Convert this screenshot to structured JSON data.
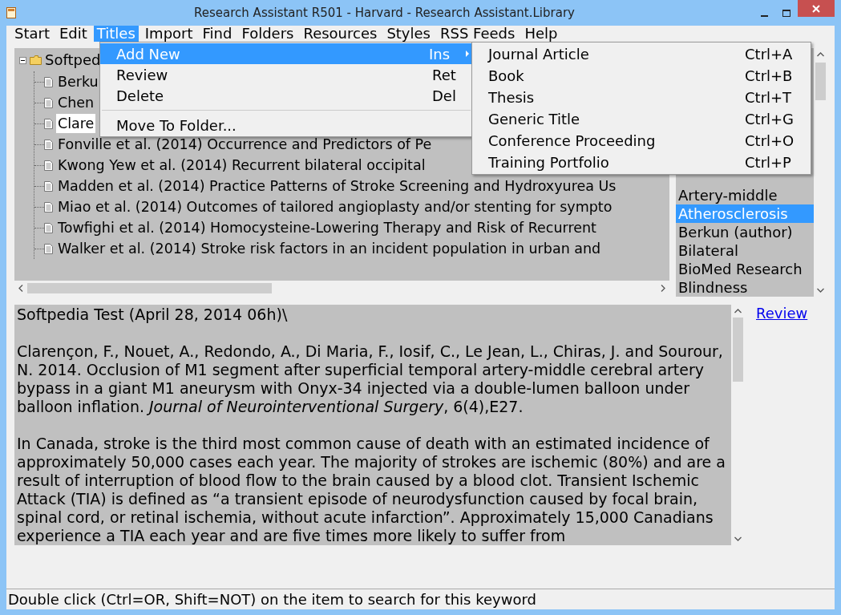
{
  "window": {
    "title": "Research Assistant R501 - Harvard - Research Assistant.Library"
  },
  "menu_bar": [
    {
      "label": "Start",
      "selected": false
    },
    {
      "label": "Edit",
      "selected": false
    },
    {
      "label": "Titles",
      "selected": true
    },
    {
      "label": "Import",
      "selected": false
    },
    {
      "label": "Find",
      "selected": false
    },
    {
      "label": "Folders",
      "selected": false
    },
    {
      "label": "Resources",
      "selected": false
    },
    {
      "label": "Styles",
      "selected": false
    },
    {
      "label": "RSS Feeds",
      "selected": false
    },
    {
      "label": "Help",
      "selected": false
    }
  ],
  "titles_menu": [
    {
      "kind": "item",
      "label": "Add New",
      "shortcut": "Ins",
      "selected": true,
      "submenu": true
    },
    {
      "kind": "item",
      "label": "Review",
      "shortcut": "Ret",
      "selected": false,
      "submenu": false
    },
    {
      "kind": "item",
      "label": "Delete",
      "shortcut": "Del",
      "selected": false,
      "submenu": false
    },
    {
      "kind": "separator"
    },
    {
      "kind": "item",
      "label": "Move To Folder...",
      "selected": false,
      "submenu": false
    }
  ],
  "add_new_submenu": [
    {
      "label": "Journal Article",
      "shortcut": "Ctrl+A"
    },
    {
      "label": "Book",
      "shortcut": "Ctrl+B"
    },
    {
      "label": "Thesis",
      "shortcut": "Ctrl+T"
    },
    {
      "label": "Generic Title",
      "shortcut": "Ctrl+G"
    },
    {
      "label": "Conference Proceeding",
      "shortcut": "Ctrl+O"
    },
    {
      "label": "Training Portfolio",
      "shortcut": "Ctrl+P"
    }
  ],
  "tree": {
    "label": "Softped",
    "expanded": true,
    "children": [
      {
        "label": "Berku",
        "selected": false
      },
      {
        "label": "Chen",
        "selected": false
      },
      {
        "label": "Clare",
        "selected": true
      },
      {
        "label": "Fonville et al. (2014) Occurrence and Predictors of Pe",
        "selected": false
      },
      {
        "label": "Kwong Yew et al. (2014) Recurrent bilateral occipital",
        "selected": false
      },
      {
        "label": "Madden et al. (2014) Practice Patterns of Stroke Screening and Hydroxyurea Us",
        "selected": false
      },
      {
        "label": "Miao et al. (2014) Outcomes of tailored angioplasty and/or stenting for sympto",
        "selected": false
      },
      {
        "label": "Towfighi et al. (2014) Homocysteine-Lowering Therapy and Risk of Recurrent",
        "selected": false
      },
      {
        "label": "Walker et al. (2014) Stroke risk factors in an incident population in urban and",
        "selected": false
      }
    ]
  },
  "keywords": [
    {
      "label": "Artery-middle",
      "selected": false
    },
    {
      "label": "Atherosclerosis",
      "selected": true
    },
    {
      "label": "Berkun (author)",
      "selected": false
    },
    {
      "label": "Bilateral",
      "selected": false
    },
    {
      "label": "BioMed Research",
      "selected": false
    },
    {
      "label": "Blindness",
      "selected": false
    }
  ],
  "preview": {
    "paragraphs": [
      "Softpedia Test (April 28, 2014 06h)\\",
      "Clarençon, F., Nouet, A., Redondo, A., Di Maria, F., Iosif, C., Le Jean, L., Chiras, J. and Sourour, N. 2014. Occlusion of M1 segment after superficial temporal artery-middle cerebral artery bypass in a giant M1 aneurysm with Onyx-34 injected via a double-lumen balloon under balloon inflation. *Journal of Neurointerventional Surgery*, 6(4),E27.",
      "In Canada, stroke is the third most common cause of death with an estimated incidence of approximately 50,000 cases each year. The majority of strokes are ischemic (80%) and are a result of interruption of blood flow to the brain caused by a blood clot. Transient Ischemic Attack (TIA) is defined as “a transient episode of neurodysfunction caused by focal brain, spinal cord, or retinal ischemia, without acute infarction”. Approximately 15,000 Canadians experience a TIA each year and are five times more likely to suffer from"
    ]
  },
  "review_link": "Review",
  "status_bar": "Double click (Ctrl=OR, Shift=NOT) on the item to search for this keyword"
}
